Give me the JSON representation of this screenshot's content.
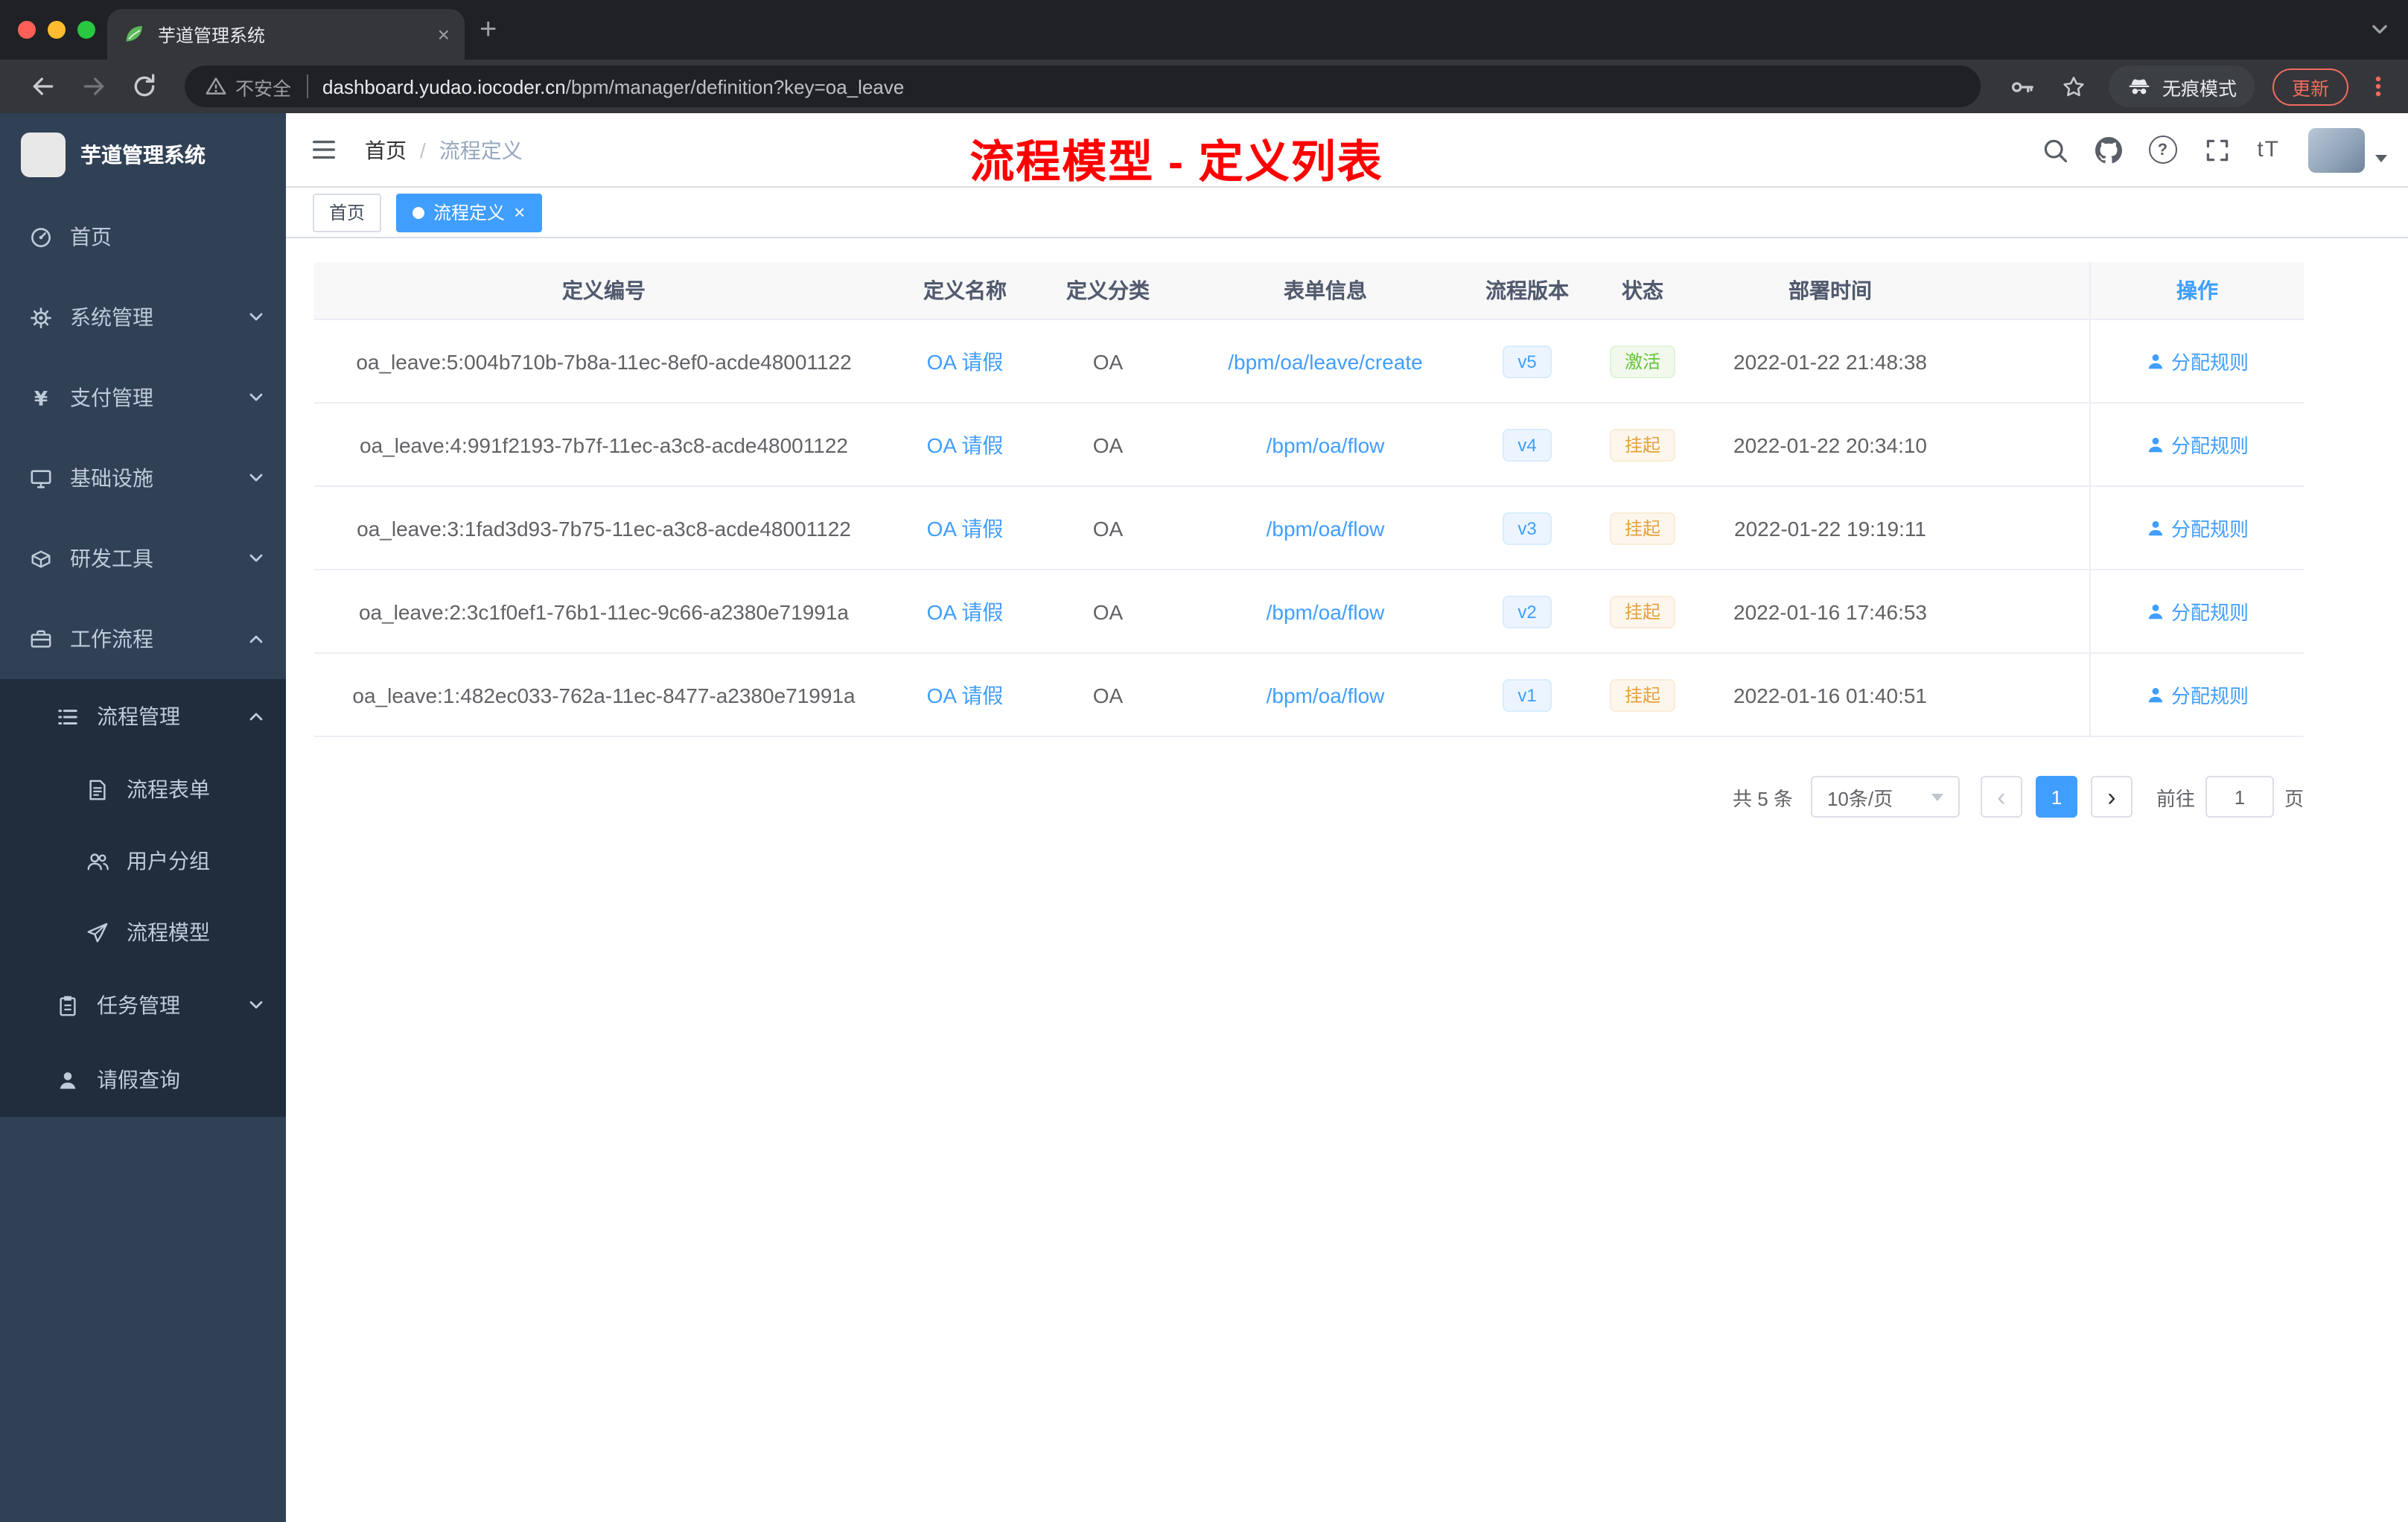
{
  "colors": {
    "accent": "#409eff",
    "success": "#67c23a",
    "warning": "#e6a23c",
    "annotation_red": "#ff0000",
    "sidebar_bg": "#304156"
  },
  "browser": {
    "tab_title": "芋道管理系统",
    "security_label": "不安全",
    "url_host": "dashboard.yudao.iocoder.cn",
    "url_path": "/bpm/manager/definition?key=oa_leave",
    "incognito_label": "无痕模式",
    "update_label": "更新"
  },
  "sidebar": {
    "app_title": "芋道管理系统",
    "items": [
      {
        "label": "首页"
      },
      {
        "label": "系统管理"
      },
      {
        "label": "支付管理"
      },
      {
        "label": "基础设施"
      },
      {
        "label": "研发工具"
      },
      {
        "label": "工作流程"
      },
      {
        "label": "流程管理"
      },
      {
        "label": "流程表单"
      },
      {
        "label": "用户分组"
      },
      {
        "label": "流程模型"
      },
      {
        "label": "任务管理"
      },
      {
        "label": "请假查询"
      }
    ]
  },
  "header": {
    "breadcrumb": [
      "首页",
      "流程定义"
    ],
    "annotation": "流程模型 - 定义列表"
  },
  "tags": {
    "home": "首页",
    "active": "流程定义"
  },
  "table": {
    "columns": [
      "定义编号",
      "定义名称",
      "定义分类",
      "表单信息",
      "流程版本",
      "状态",
      "部署时间",
      "操作"
    ],
    "rows": [
      {
        "id": "oa_leave:5:004b710b-7b8a-11ec-8ef0-acde48001122",
        "name": "OA 请假",
        "category": "OA",
        "form": "/bpm/oa/leave/create",
        "version": "v5",
        "status": "激活",
        "status_type": "success",
        "deploy_time": "2022-01-22 21:48:38",
        "action": "分配规则"
      },
      {
        "id": "oa_leave:4:991f2193-7b7f-11ec-a3c8-acde48001122",
        "name": "OA 请假",
        "category": "OA",
        "form": "/bpm/oa/flow",
        "version": "v4",
        "status": "挂起",
        "status_type": "warning",
        "deploy_time": "2022-01-22 20:34:10",
        "action": "分配规则"
      },
      {
        "id": "oa_leave:3:1fad3d93-7b75-11ec-a3c8-acde48001122",
        "name": "OA 请假",
        "category": "OA",
        "form": "/bpm/oa/flow",
        "version": "v3",
        "status": "挂起",
        "status_type": "warning",
        "deploy_time": "2022-01-22 19:19:11",
        "action": "分配规则"
      },
      {
        "id": "oa_leave:2:3c1f0ef1-76b1-11ec-9c66-a2380e71991a",
        "name": "OA 请假",
        "category": "OA",
        "form": "/bpm/oa/flow",
        "version": "v2",
        "status": "挂起",
        "status_type": "warning",
        "deploy_time": "2022-01-16 17:46:53",
        "action": "分配规则"
      },
      {
        "id": "oa_leave:1:482ec033-762a-11ec-8477-a2380e71991a",
        "name": "OA 请假",
        "category": "OA",
        "form": "/bpm/oa/flow",
        "version": "v1",
        "status": "挂起",
        "status_type": "warning",
        "deploy_time": "2022-01-16 01:40:51",
        "action": "分配规则"
      }
    ]
  },
  "pagination": {
    "total": "共 5 条",
    "page_size": "10条/页",
    "current_page": "1",
    "goto_label": "前往",
    "goto_value": "1",
    "page_unit": "页"
  }
}
